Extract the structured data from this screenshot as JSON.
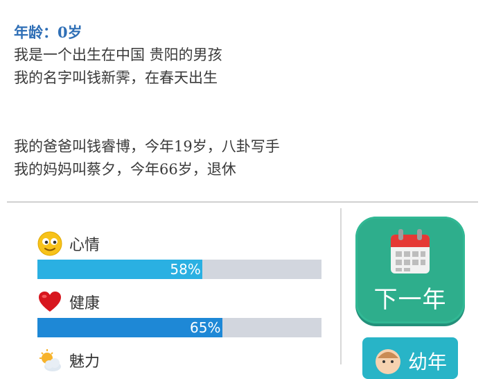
{
  "story": {
    "age_label": "年龄：0岁",
    "line1": "我是一个出生在中国 贵阳的男孩",
    "line2": "我的名字叫钱新霁，在春天出生",
    "line3": "我的爸爸叫钱睿博，今年19岁，八卦写手",
    "line4": "我的妈妈叫蔡夕，今年66岁，退休"
  },
  "stats": [
    {
      "label": "心情",
      "icon": "smiley-icon",
      "value": 58,
      "value_text": "58%",
      "color": "#2ab0e2"
    },
    {
      "label": "健康",
      "icon": "heart-icon",
      "value": 65,
      "value_text": "65%",
      "color": "#1e88d6"
    },
    {
      "label": "魅力",
      "icon": "weather-icon"
    }
  ],
  "buttons": {
    "next_year": "下一年",
    "young": "幼年"
  },
  "colors": {
    "accent_green": "#2eae8c",
    "accent_teal": "#28b4c7",
    "age_blue": "#2f6fb6"
  }
}
